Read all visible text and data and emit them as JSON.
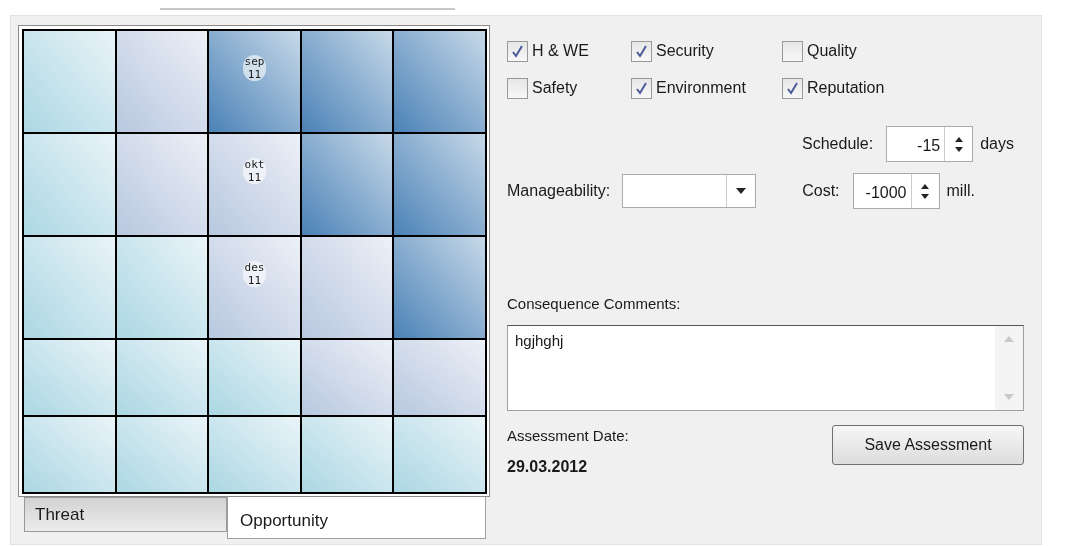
{
  "matrix": {
    "rows": [
      [
        {
          "kind": "low"
        },
        {
          "kind": "medium"
        },
        {
          "kind": "high",
          "marker": [
            "sep",
            "11"
          ]
        },
        {
          "kind": "high"
        },
        {
          "kind": "high"
        }
      ],
      [
        {
          "kind": "low"
        },
        {
          "kind": "medium"
        },
        {
          "kind": "medium",
          "marker": [
            "okt",
            "11"
          ]
        },
        {
          "kind": "high"
        },
        {
          "kind": "high"
        }
      ],
      [
        {
          "kind": "low"
        },
        {
          "kind": "low"
        },
        {
          "kind": "medium",
          "marker": [
            "des",
            "11"
          ]
        },
        {
          "kind": "medium"
        },
        {
          "kind": "high"
        }
      ],
      [
        {
          "kind": "low"
        },
        {
          "kind": "low"
        },
        {
          "kind": "low"
        },
        {
          "kind": "medium"
        },
        {
          "kind": "medium"
        }
      ],
      [
        {
          "kind": "low"
        },
        {
          "kind": "low"
        },
        {
          "kind": "low"
        },
        {
          "kind": "low"
        },
        {
          "kind": "low"
        }
      ]
    ]
  },
  "tabs": [
    {
      "label": "Threat",
      "selected": false
    },
    {
      "label": "Opportunity",
      "selected": true
    }
  ],
  "categories": [
    {
      "label": "H & WE",
      "checked": true
    },
    {
      "label": "Security",
      "checked": true
    },
    {
      "label": "Quality",
      "checked": false
    },
    {
      "label": "Safety",
      "checked": false
    },
    {
      "label": "Environment",
      "checked": true
    },
    {
      "label": "Reputation",
      "checked": true
    }
  ],
  "schedule": {
    "label": "Schedule:",
    "value": "-15",
    "unit": "days"
  },
  "manageability": {
    "label": "Manageability:"
  },
  "cost": {
    "label": "Cost:",
    "value": "-1000",
    "unit": "mill."
  },
  "comments": {
    "label": "Consequence Comments:",
    "value": "hgjhghj"
  },
  "assessment_date": {
    "label": "Assessment Date:",
    "value": "29.03.2012"
  },
  "save_button": "Save Assessment"
}
